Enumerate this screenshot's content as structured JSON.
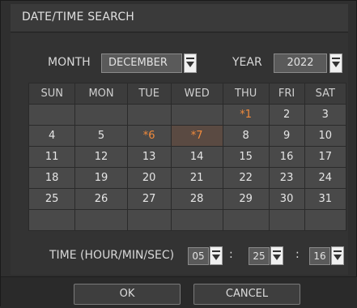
{
  "dialog": {
    "title": "DATE/TIME SEARCH"
  },
  "month": {
    "label": "MONTH",
    "value": "DECEMBER"
  },
  "year": {
    "label": "YEAR",
    "value": "2022"
  },
  "calendar": {
    "weekdays": [
      "SUN",
      "MON",
      "TUE",
      "WED",
      "THU",
      "FRI",
      "SAT"
    ],
    "weeks": [
      [
        "",
        "",
        "",
        "",
        "*1",
        "2",
        "3"
      ],
      [
        "4",
        "5",
        "*6",
        "*7",
        "8",
        "9",
        "10"
      ],
      [
        "11",
        "12",
        "13",
        "14",
        "15",
        "16",
        "17"
      ],
      [
        "18",
        "19",
        "20",
        "21",
        "22",
        "23",
        "24"
      ],
      [
        "25",
        "26",
        "27",
        "28",
        "29",
        "30",
        "31"
      ],
      [
        "",
        "",
        "",
        "",
        "",
        "",
        ""
      ]
    ],
    "recorded_days": [
      "*1",
      "*6",
      "*7"
    ],
    "highlighted_day": "*7"
  },
  "time": {
    "label": "TIME (HOUR/MIN/SEC)",
    "hour": "05",
    "minute": "25",
    "second": "16",
    "separator": ":"
  },
  "buttons": {
    "ok": "OK",
    "cancel": "CANCEL"
  },
  "colors": {
    "recorded_day": "#f08a3c",
    "panel": "#333333",
    "cell": "#494949"
  },
  "icons": {
    "dropdown": "chevron-down-icon"
  }
}
